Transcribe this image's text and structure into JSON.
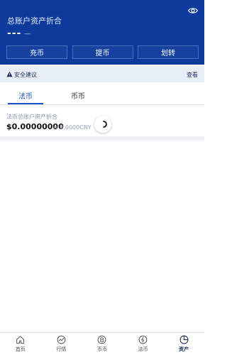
{
  "header": {
    "title": "总账户资产折合",
    "masked_value": "---",
    "masked_sub": "—",
    "actions": [
      {
        "label": "充币"
      },
      {
        "label": "提币"
      },
      {
        "label": "划转"
      }
    ]
  },
  "notice": {
    "label": "安全建议",
    "link": "查看"
  },
  "tabs": [
    {
      "label": "法币"
    },
    {
      "label": "币币"
    }
  ],
  "summary": {
    "label": "法币总账户资产折合",
    "value": "$0.00000000",
    "approx": "≈ 0.0000CNY"
  },
  "bottom_nav": [
    {
      "label": "首页",
      "icon": "home-icon"
    },
    {
      "label": "行情",
      "icon": "chart-icon"
    },
    {
      "label": "币币",
      "icon": "bitcoin-icon"
    },
    {
      "label": "法币",
      "icon": "fiat-icon"
    },
    {
      "label": "资产",
      "icon": "pie-icon"
    }
  ],
  "colors": {
    "header_bg": "#0d3a9b",
    "accent": "#1a4fc4"
  }
}
